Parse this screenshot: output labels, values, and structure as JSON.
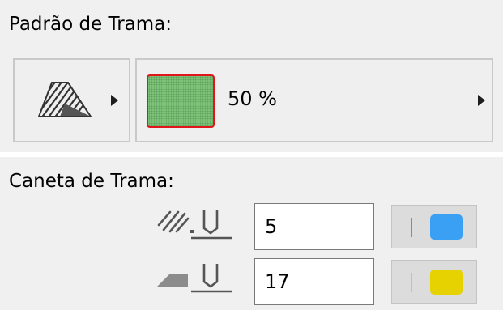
{
  "fill_pattern": {
    "label": "Padrão de Trama:",
    "pattern_icon": "hatch-pattern-icon",
    "fill_color": "#7ec27a",
    "fill_border_color": "#e0161b",
    "percent_text": "50 %"
  },
  "fill_pen": {
    "label": "Caneta de Trama:",
    "hatch_pen": {
      "icon": "hatch-lines-pen-icon",
      "value": "5",
      "color": "#3aa0f4"
    },
    "background_pen": {
      "icon": "solid-background-pen-icon",
      "value": "17",
      "color": "#e6d200"
    }
  }
}
